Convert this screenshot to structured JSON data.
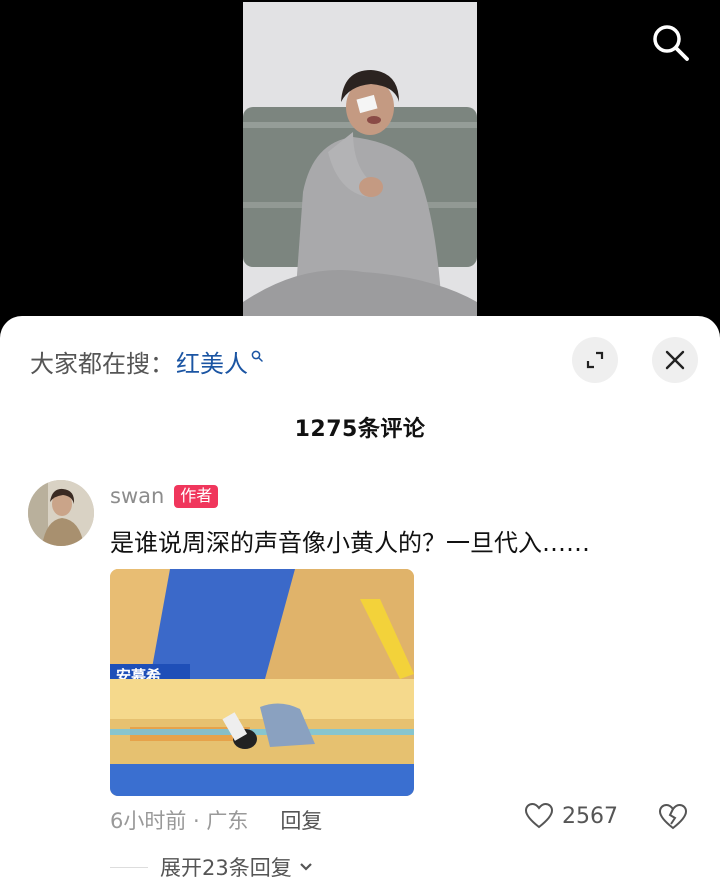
{
  "trending": {
    "label": "大家都在搜：",
    "term": "红美人"
  },
  "comments_header": {
    "count_label": "1275条评论"
  },
  "comment": {
    "username": "swan",
    "author_badge": "作者",
    "text": "是谁说周深的声音像小黄人的？一旦代入……",
    "image_overlay_text": "安慕希",
    "time_location": "6小时前 · 广东",
    "reply_label": "回复",
    "like_count": "2567",
    "expand_replies_label": "展开23条回复"
  },
  "icons": {
    "top_search": "search-icon",
    "trend_search": "search-small-icon",
    "expand": "expand-icon",
    "close": "close-icon",
    "like": "heart-icon",
    "dislike": "broken-heart-icon",
    "chevron": "chevron-down-icon"
  },
  "colors": {
    "badge": "#f0365c",
    "trend_term": "#1b55a3",
    "sheet_bg": "#ffffff",
    "video_bg": "#000000"
  }
}
